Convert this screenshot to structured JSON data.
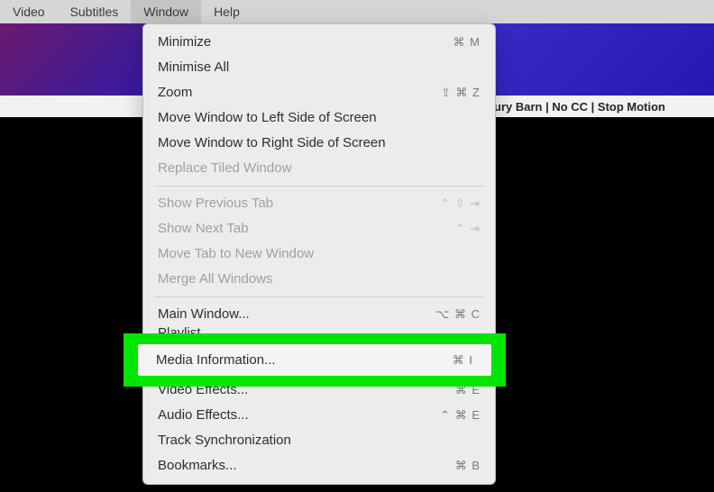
{
  "menubar": {
    "items": [
      {
        "label": "Video"
      },
      {
        "label": "Subtitles"
      },
      {
        "label": "Window"
      },
      {
        "label": "Help"
      }
    ]
  },
  "title": "ury Barn | No CC | Stop Motion ",
  "dropdown": {
    "groups": [
      [
        {
          "label": "Minimize",
          "shortcut": "⌘ M",
          "enabled": true
        },
        {
          "label": "Minimise All",
          "shortcut": "",
          "enabled": true
        },
        {
          "label": "Zoom",
          "shortcut": "⇧ ⌘ Z",
          "enabled": true
        },
        {
          "label": "Move Window to Left Side of Screen",
          "shortcut": "",
          "enabled": true
        },
        {
          "label": "Move Window to Right Side of Screen",
          "shortcut": "",
          "enabled": true
        },
        {
          "label": "Replace Tiled Window",
          "shortcut": "",
          "enabled": false
        }
      ],
      [
        {
          "label": "Show Previous Tab",
          "shortcut": "⌃ ⇧ ⇥",
          "enabled": false
        },
        {
          "label": "Show Next Tab",
          "shortcut": "⌃ ⇥",
          "enabled": false
        },
        {
          "label": "Move Tab to New Window",
          "shortcut": "",
          "enabled": false
        },
        {
          "label": "Merge All Windows",
          "shortcut": "",
          "enabled": false
        }
      ],
      [
        {
          "label": "Main Window...",
          "shortcut": "⌥ ⌘ C",
          "enabled": true
        },
        {
          "label": "Playlist",
          "shortcut": "",
          "enabled": true
        }
      ],
      [
        {
          "label": "Video Effects...",
          "shortcut": "⌘ E",
          "enabled": true
        },
        {
          "label": "Audio Effects...",
          "shortcut": "⌃ ⌘ E",
          "enabled": true
        },
        {
          "label": "Track Synchronization",
          "shortcut": "",
          "enabled": true
        },
        {
          "label": "Bookmarks...",
          "shortcut": "⌘ B",
          "enabled": true
        }
      ]
    ],
    "highlighted": {
      "label": "Media Information...",
      "shortcut": "⌘ I"
    }
  }
}
